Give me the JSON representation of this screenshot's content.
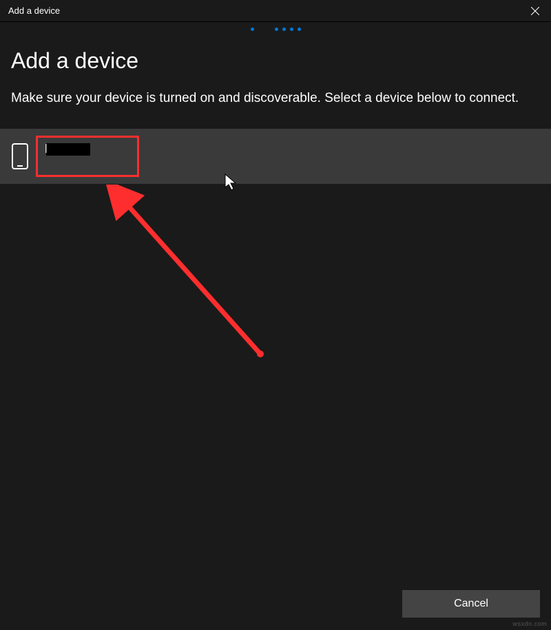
{
  "titlebar": {
    "title": "Add a device"
  },
  "header": {
    "heading": "Add a device",
    "subheading": "Make sure your device is turned on and discoverable. Select a device below to connect."
  },
  "devices": [
    {
      "icon": "phone-icon",
      "name_redacted": true
    }
  ],
  "footer": {
    "cancel_label": "Cancel"
  },
  "watermark": "wsxdn.com"
}
